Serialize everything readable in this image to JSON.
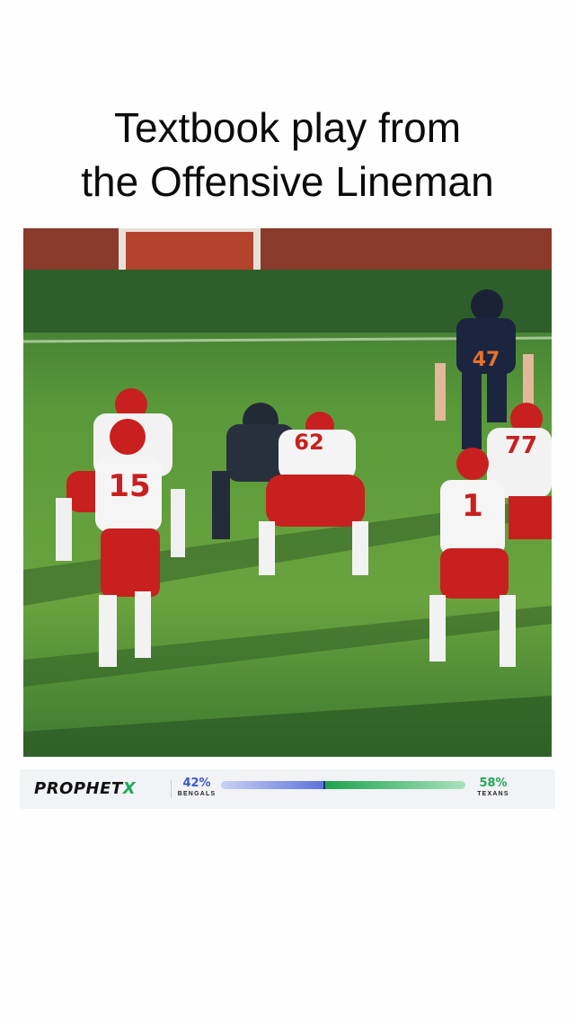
{
  "post": {
    "title_line1": "Textbook play from",
    "title_line2": "the Offensive Lineman"
  },
  "video": {
    "jersey_numbers": [
      "15",
      "1",
      "77",
      "47",
      "62"
    ]
  },
  "poll_bar": {
    "brand_main": "PROPHET",
    "brand_x": "X",
    "left_team": {
      "pct_label": "42%",
      "name": "BENGALS",
      "share": 0.42,
      "color": "#3e58c9"
    },
    "right_team": {
      "pct_label": "58%",
      "name": "TEXANS",
      "share": 0.58,
      "color": "#22a55a"
    }
  }
}
